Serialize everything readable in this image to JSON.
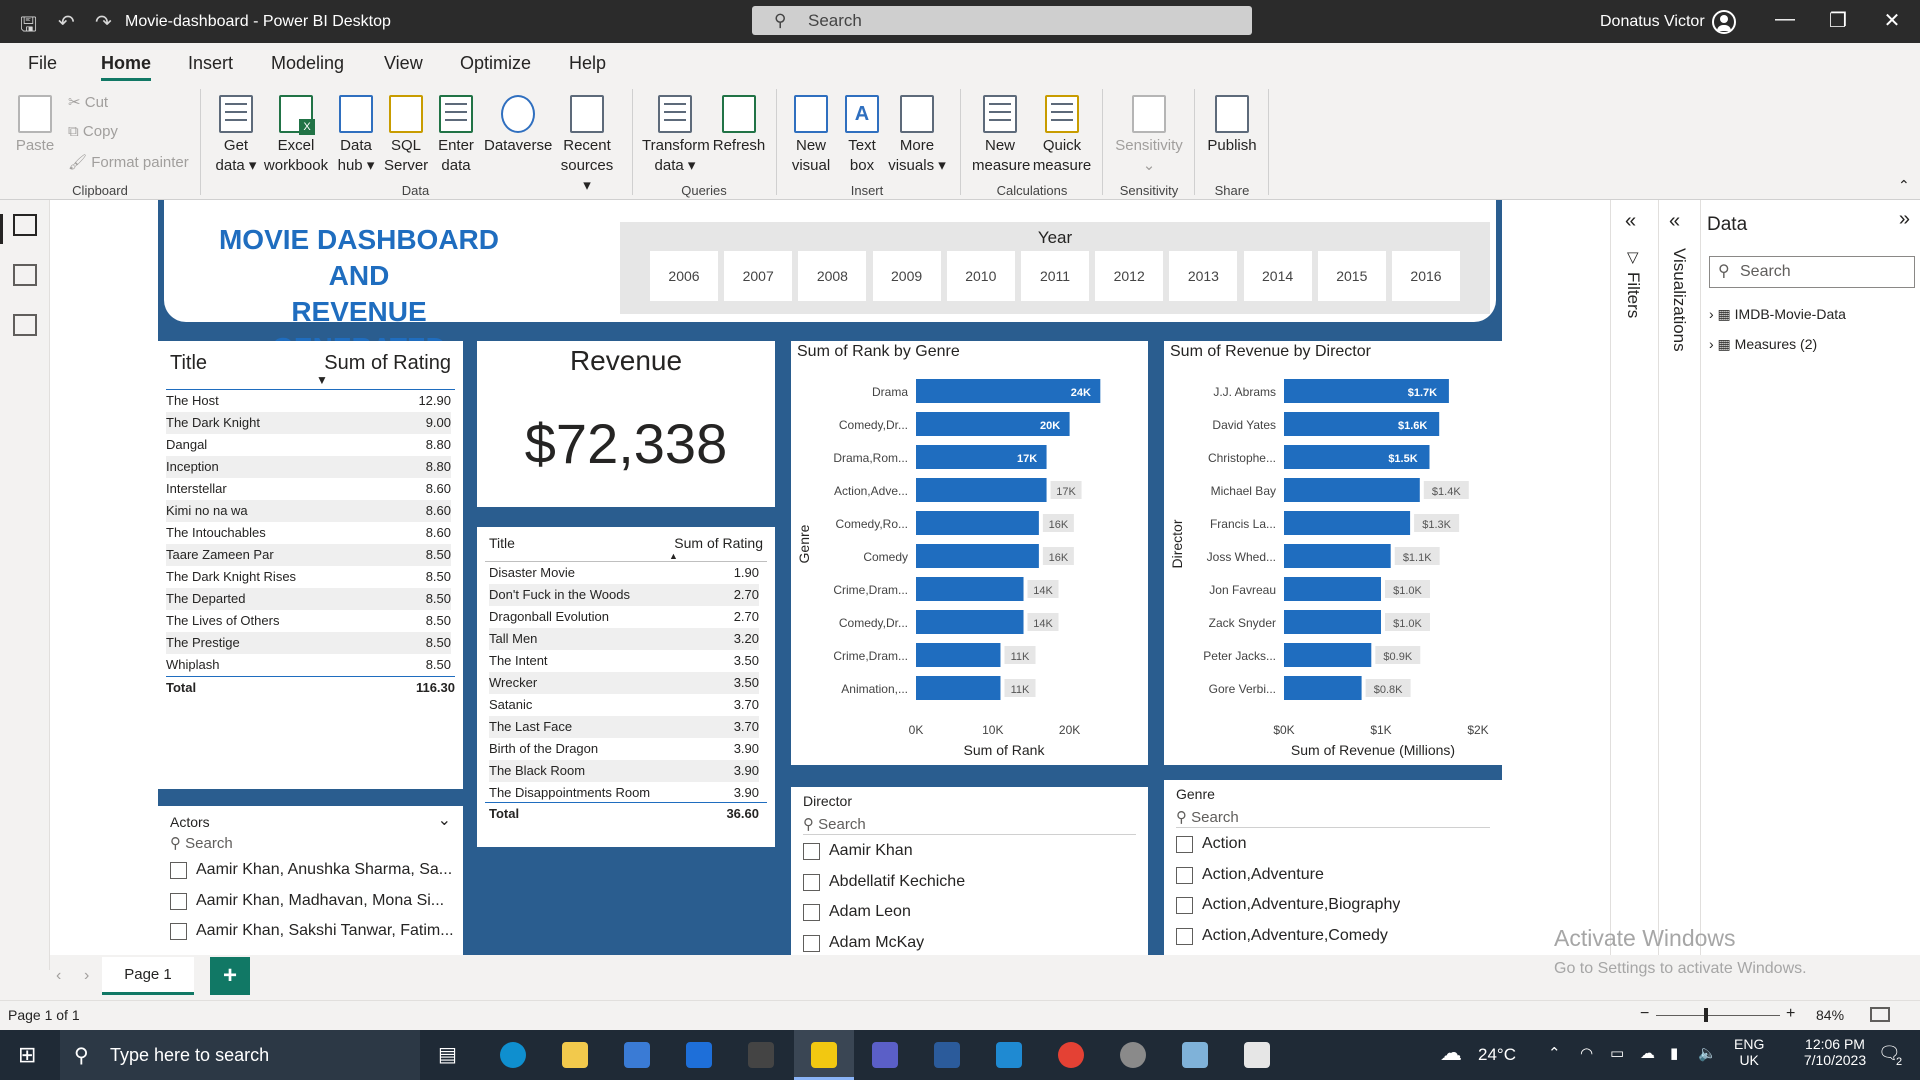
{
  "window": {
    "title": "Movie-dashboard - Power BI Desktop",
    "search_placeholder": "Search",
    "user": "Donatus Victor"
  },
  "menu": [
    "File",
    "Home",
    "Insert",
    "Modeling",
    "View",
    "Optimize",
    "Help"
  ],
  "ribbon": {
    "paste": "Paste",
    "cut": "Cut",
    "copy": "Copy",
    "format_painter": "Format painter",
    "get_data": "Get data",
    "excel": "Excel workbook",
    "data_hub": "Data hub",
    "sql": "SQL Server",
    "enter_data": "Enter data",
    "dataverse": "Dataverse",
    "recent": "Recent sources",
    "transform": "Transform data",
    "refresh": "Refresh",
    "new_visual": "New visual",
    "text_box": "Text box",
    "more_visuals": "More visuals",
    "new_measure": "New measure",
    "quick_measure": "Quick measure",
    "sensitivity": "Sensitivity",
    "publish": "Publish",
    "groups": {
      "clipboard": "Clipboard",
      "data": "Data",
      "queries": "Queries",
      "insert": "Insert",
      "calculations": "Calculations",
      "sensitivity": "Sensitivity",
      "share": "Share"
    }
  },
  "dashboard": {
    "title_line1": "MOVIE DASHBOARD AND",
    "title_line2": "REVENUE GENERATED",
    "year_label": "Year",
    "years": [
      "2006",
      "2007",
      "2008",
      "2009",
      "2010",
      "2011",
      "2012",
      "2013",
      "2014",
      "2015",
      "2016"
    ]
  },
  "top_table": {
    "col1": "Title",
    "col2": "Sum of Rating",
    "rows": [
      [
        "The Host",
        "12.90"
      ],
      [
        "The Dark Knight",
        "9.00"
      ],
      [
        "Dangal",
        "8.80"
      ],
      [
        "Inception",
        "8.80"
      ],
      [
        "Interstellar",
        "8.60"
      ],
      [
        "Kimi no na wa",
        "8.60"
      ],
      [
        "The Intouchables",
        "8.60"
      ],
      [
        "Taare Zameen Par",
        "8.50"
      ],
      [
        "The Dark Knight Rises",
        "8.50"
      ],
      [
        "The Departed",
        "8.50"
      ],
      [
        "The Lives of Others",
        "8.50"
      ],
      [
        "The Prestige",
        "8.50"
      ],
      [
        "Whiplash",
        "8.50"
      ]
    ],
    "total_label": "Total",
    "total": "116.30"
  },
  "revenue_card": {
    "title": "Revenue",
    "value": "$72,338"
  },
  "bottom_table": {
    "col1": "Title",
    "col2": "Sum of Rating",
    "rows": [
      [
        "Disaster Movie",
        "1.90"
      ],
      [
        "Don't Fuck in the Woods",
        "2.70"
      ],
      [
        "Dragonball Evolution",
        "2.70"
      ],
      [
        "Tall Men",
        "3.20"
      ],
      [
        "The Intent",
        "3.50"
      ],
      [
        "Wrecker",
        "3.50"
      ],
      [
        "Satanic",
        "3.70"
      ],
      [
        "The Last Face",
        "3.70"
      ],
      [
        "Birth of the Dragon",
        "3.90"
      ],
      [
        "The Black Room",
        "3.90"
      ],
      [
        "The Disappointments Room",
        "3.90"
      ]
    ],
    "total_label": "Total",
    "total": "36.60"
  },
  "chart_data": [
    {
      "type": "bar",
      "orientation": "horizontal",
      "title": "Sum of Rank by Genre",
      "xlabel": "Sum of Rank",
      "ylabel": "Genre",
      "categories": [
        "Drama",
        "Comedy,Dr...",
        "Drama,Rom...",
        "Action,Adve...",
        "Comedy,Ro...",
        "Comedy",
        "Crime,Dram...",
        "Comedy,Dr...",
        "Crime,Dram...",
        "Animation,..."
      ],
      "values": [
        24000,
        20000,
        17000,
        17000,
        16000,
        16000,
        14000,
        14000,
        11000,
        11000
      ],
      "labels": [
        "24K",
        "20K",
        "17K",
        "17K",
        "16K",
        "16K",
        "14K",
        "14K",
        "11K",
        "11K"
      ],
      "xlim": [
        0,
        25000
      ],
      "xticks": [
        "0K",
        "10K",
        "20K"
      ],
      "xtick_values": [
        0,
        10000,
        20000
      ],
      "bar_color": "#1f6dbf"
    },
    {
      "type": "bar",
      "orientation": "horizontal",
      "title": "Sum of Revenue by Director",
      "xlabel": "Sum of Revenue (Millions)",
      "ylabel": "Director",
      "categories": [
        "J.J. Abrams",
        "David Yates",
        "Christophe...",
        "Michael Bay",
        "Francis La...",
        "Joss Whed...",
        "Jon Favreau",
        "Zack Snyder",
        "Peter Jacks...",
        "Gore Verbi..."
      ],
      "values": [
        1.7,
        1.6,
        1.5,
        1.4,
        1.3,
        1.1,
        1.0,
        1.0,
        0.9,
        0.8
      ],
      "labels": [
        "$1.7K",
        "$1.6K",
        "$1.5K",
        "$1.4K",
        "$1.3K",
        "$1.1K",
        "$1.0K",
        "$1.0K",
        "$0.9K",
        "$0.8K"
      ],
      "xlim": [
        0,
        2
      ],
      "xticks": [
        "$0K",
        "$1K",
        "$2K"
      ],
      "xtick_values": [
        0,
        1,
        2
      ],
      "bar_color": "#1f6dbf"
    }
  ],
  "actors_slicer": {
    "title": "Actors",
    "search": "Search",
    "items": [
      "Aamir Khan, Anushka Sharma, Sa...",
      "Aamir Khan, Madhavan, Mona Si...",
      "Aamir Khan, Sakshi Tanwar, Fatim..."
    ]
  },
  "director_slicer": {
    "title": "Director",
    "search": "Search",
    "items": [
      "Aamir Khan",
      "Abdellatif Kechiche",
      "Adam Leon",
      "Adam McKay"
    ]
  },
  "genre_slicer": {
    "title": "Genre",
    "search": "Search",
    "items": [
      "Action",
      "Action,Adventure",
      "Action,Adventure,Biography",
      "Action,Adventure,Comedy"
    ]
  },
  "panes": {
    "filters": "Filters",
    "visualizations": "Visualizations",
    "data": "Data",
    "search": "Search",
    "tables": [
      "IMDB-Movie-Data",
      "Measures (2)"
    ]
  },
  "pages": {
    "tab": "Page 1",
    "add": "+"
  },
  "status": {
    "page": "Page 1 of 1",
    "zoom": "84%",
    "watermark1": "Activate Windows",
    "watermark2": "Go to Settings to activate Windows."
  },
  "taskbar": {
    "search": "Type here to search",
    "weather": "24°C",
    "lang1": "ENG",
    "lang2": "UK",
    "time": "12:06 PM",
    "date": "7/10/2023",
    "notif": "2"
  },
  "colors": {
    "report_bg": "#2a5d8f",
    "accent": "#117865",
    "bar": "#1f6dbf",
    "title_blue": "#1f6dbf"
  }
}
